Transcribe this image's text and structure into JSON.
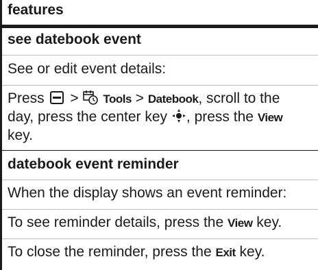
{
  "header": {
    "title": "features"
  },
  "sections": [
    {
      "title": "see datebook event",
      "intro": "See or edit event details:",
      "step": {
        "press": "Press",
        "gt1": ">",
        "tools": "Tools",
        "gt2": ">",
        "datebook": "Datebook",
        "after_datebook": ", scroll to the",
        "line2_a": "day, press the center key",
        "line2_b": ", press the",
        "view": "View",
        "line3": "key."
      }
    },
    {
      "title": "datebook event reminder",
      "line1": "When the display shows an event reminder:",
      "line2_a": "To see reminder details, press the",
      "view": "View",
      "line2_b": "key.",
      "line3_a": "To close the reminder, press the",
      "exit": "Exit",
      "line3_b": "key."
    }
  ],
  "icons": [
    "menu-key-icon",
    "tools-icon",
    "center-key-icon"
  ]
}
